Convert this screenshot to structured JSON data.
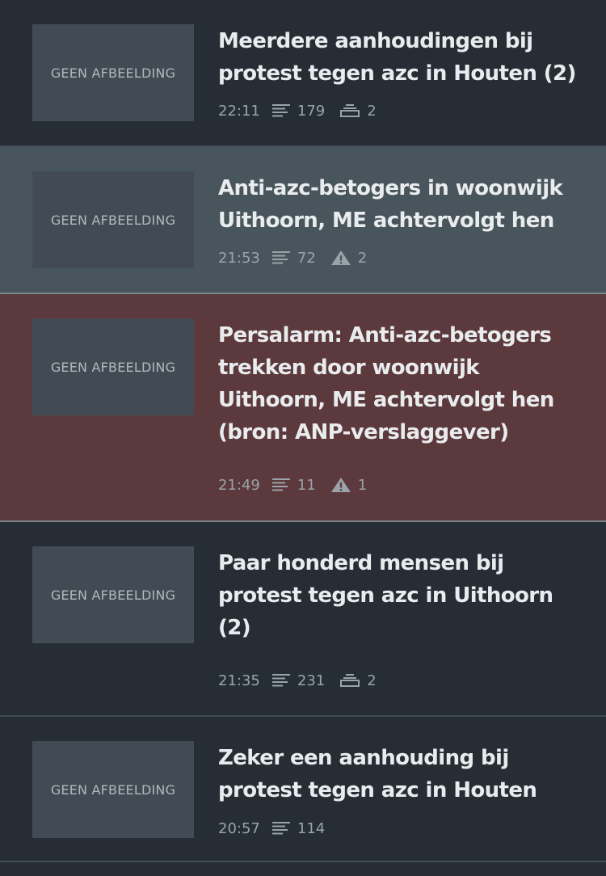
{
  "placeholder_text": "GEEN AFBEELDING",
  "items": [
    {
      "title": "Meerdere aanhoudingen bij protest tegen azc in Houten (2)",
      "time": "22:11",
      "words": "179",
      "badge_icon": "layers-icon",
      "badge_count": "2",
      "style": "normal"
    },
    {
      "title": "Anti-azc-betogers in woonwijk Uithoorn, ME achtervolgt hen",
      "time": "21:53",
      "words": "72",
      "badge_icon": "warning-icon",
      "badge_count": "2",
      "style": "highlight"
    },
    {
      "title": "Persalarm: Anti-azc-betogers trekken door woonwijk Uithoorn, ME achtervolgt hen (bron: ANP-verslaggever)",
      "time": "21:49",
      "words": "11",
      "badge_icon": "warning-icon",
      "badge_count": "1",
      "style": "alert"
    },
    {
      "title": "Paar honderd mensen bij protest tegen azc in Uithoorn (2)",
      "time": "21:35",
      "words": "231",
      "badge_icon": "layers-icon",
      "badge_count": "2",
      "style": "normal"
    },
    {
      "title": "Zeker een aanhouding bij protest tegen azc in Houten",
      "time": "20:57",
      "words": "114",
      "badge_icon": "",
      "badge_count": "",
      "style": "normal"
    }
  ],
  "colors": {
    "background": "#262d35",
    "highlight_bg": "#48555c",
    "alert_bg": "#5c393c",
    "thumb_bg": "#424b54",
    "title_text": "#e9ecee",
    "meta_text": "#9aa3aa"
  }
}
